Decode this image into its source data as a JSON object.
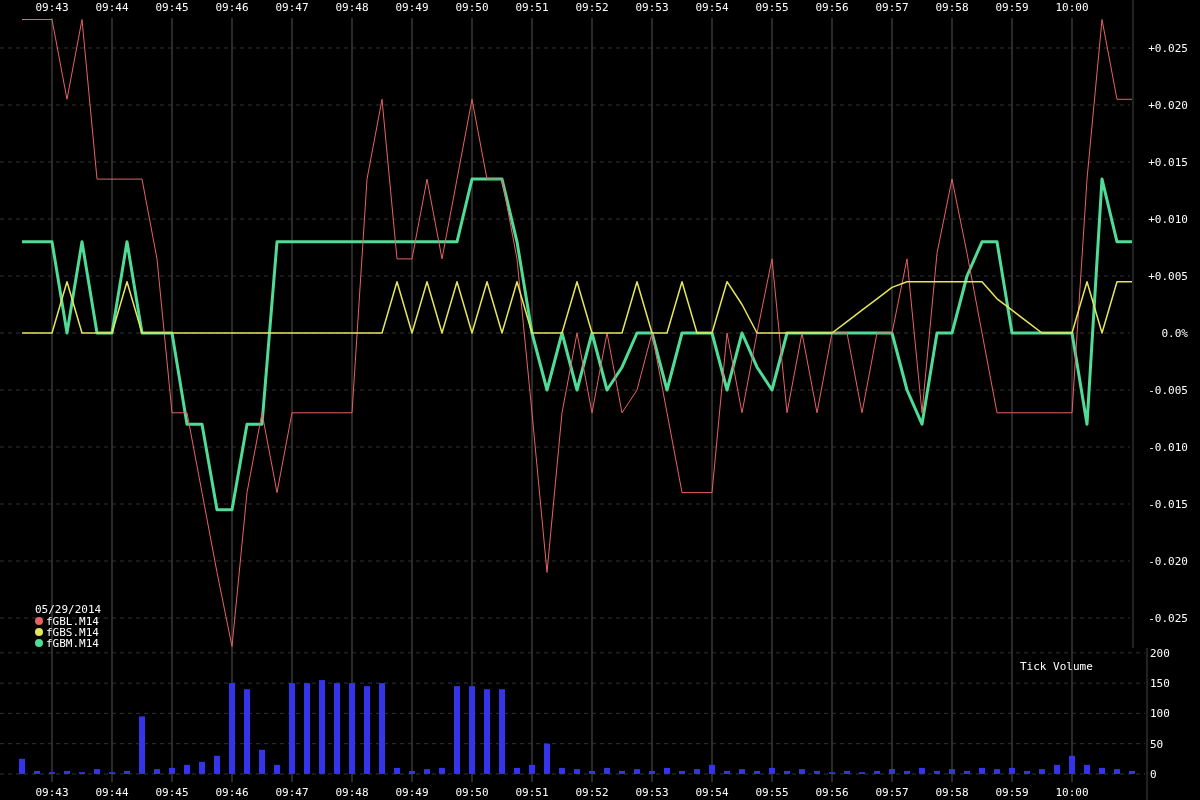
{
  "price_chart": {
    "date": "05/29/2014",
    "chart_data": {
      "type": "line",
      "grid": true,
      "legend": true,
      "ylim": [
        -0.02763,
        0.02921
      ],
      "categories": [
        null,
        null,
        "09:43",
        null,
        null,
        null,
        "09:44",
        null,
        null,
        null,
        "09:45",
        null,
        null,
        null,
        "09:46",
        null,
        null,
        null,
        "09:47",
        null,
        null,
        null,
        "09:48",
        null,
        null,
        null,
        "09:49",
        null,
        null,
        null,
        "09:50",
        null,
        null,
        null,
        "09:51",
        null,
        null,
        null,
        "09:52",
        null,
        null,
        null,
        "09:53",
        null,
        null,
        null,
        "09:54",
        null,
        null,
        null,
        "09:55",
        null,
        null,
        null,
        "09:56",
        null,
        null,
        null,
        "09:57",
        null,
        null,
        null,
        "09:58",
        null,
        null,
        null,
        "09:59",
        null,
        null,
        null,
        "10:00",
        null,
        null,
        null,
        null
      ],
      "yticks": [
        {
          "value": 0.025,
          "label": "+0.025"
        },
        {
          "value": 0.02,
          "label": "+0.020"
        },
        {
          "value": 0.015,
          "label": "+0.015"
        },
        {
          "value": 0.01,
          "label": "+0.010"
        },
        {
          "value": 0.005,
          "label": "+0.005"
        },
        {
          "value": 0,
          "label": "0.0%"
        },
        {
          "value": -0.005,
          "label": "-0.005"
        },
        {
          "value": -0.01,
          "label": "-0.010"
        },
        {
          "value": -0.015,
          "label": "-0.015"
        },
        {
          "value": -0.02,
          "label": "-0.020"
        },
        {
          "value": -0.025,
          "label": "-0.025"
        }
      ],
      "series": [
        {
          "name": "fGBL.M14",
          "color": "#e86262",
          "values": [
            0.0275,
            0.0275,
            0.0275,
            0.0205,
            0.0275,
            0.0135,
            0.0135,
            0.0135,
            0.0135,
            0.0065,
            -0.007,
            -0.007,
            -0.014,
            -0.021,
            -0.0275,
            -0.014,
            -0.007,
            -0.014,
            -0.007,
            -0.007,
            -0.007,
            -0.007,
            -0.007,
            0.0135,
            0.0205,
            0.0065,
            0.0065,
            0.0135,
            0.0065,
            0.0135,
            0.0205,
            0.0135,
            0.0135,
            0.0065,
            -0.007,
            -0.021,
            -0.007,
            0,
            -0.007,
            0,
            -0.007,
            -0.005,
            0,
            -0.007,
            -0.014,
            -0.014,
            -0.014,
            0,
            -0.007,
            0,
            0.0065,
            -0.007,
            0,
            -0.007,
            0,
            0,
            -0.007,
            0,
            0,
            0.0065,
            -0.007,
            0.007,
            0.0135,
            0.007,
            0,
            -0.007,
            -0.007,
            -0.007,
            -0.007,
            -0.007,
            -0.007,
            0.0135,
            0.0275,
            0.0205,
            0.0205
          ]
        },
        {
          "name": "fGBS.M14",
          "color": "#e6e65c",
          "values": [
            0,
            0,
            0,
            0.0045,
            0,
            0,
            0,
            0.0045,
            0,
            0,
            0,
            0,
            0,
            0,
            0,
            0,
            0,
            0,
            0,
            0,
            0,
            0,
            0,
            0,
            0,
            0.0045,
            0,
            0.0045,
            0,
            0.0045,
            0,
            0.0045,
            0,
            0.0045,
            0,
            0,
            0,
            0.0045,
            0,
            0,
            0,
            0.0045,
            0,
            0,
            0.0045,
            0,
            0,
            0.0045,
            0.0025,
            0,
            0,
            0,
            0,
            0,
            0,
            0.001,
            0.002,
            0.003,
            0.004,
            0.0045,
            0.0045,
            0.0045,
            0.0045,
            0.0045,
            0.0045,
            0.003,
            0.002,
            0.001,
            0,
            0,
            0,
            0.0045,
            0,
            0.0045,
            0.0045
          ]
        },
        {
          "name": "fGBM.M14",
          "color": "#50dc96",
          "values": [
            0.008,
            0.008,
            0.008,
            0,
            0.008,
            0,
            0,
            0.008,
            0,
            0,
            0,
            -0.008,
            -0.008,
            -0.0155,
            -0.0155,
            -0.008,
            -0.008,
            0.008,
            0.008,
            0.008,
            0.008,
            0.008,
            0.008,
            0.008,
            0.008,
            0.008,
            0.008,
            0.008,
            0.008,
            0.008,
            0.0135,
            0.0135,
            0.0135,
            0.008,
            0,
            -0.005,
            0,
            -0.005,
            0,
            -0.005,
            -0.003,
            0,
            0,
            -0.005,
            0,
            0,
            0,
            -0.005,
            0,
            -0.003,
            -0.005,
            0,
            0,
            0,
            0,
            0,
            0,
            0,
            0,
            -0.005,
            -0.008,
            0,
            0,
            0.005,
            0.008,
            0.008,
            0,
            0,
            0,
            0,
            0,
            -0.008,
            0.0135,
            0.008,
            0.008
          ]
        }
      ]
    }
  },
  "volume_chart": {
    "chart_data": {
      "type": "bar",
      "title": "Tick Volume",
      "grid": true,
      "ylim": [
        -43,
        208
      ],
      "categories": [
        null,
        null,
        "09:43",
        null,
        null,
        null,
        "09:44",
        null,
        null,
        null,
        "09:45",
        null,
        null,
        null,
        "09:46",
        null,
        null,
        null,
        "09:47",
        null,
        null,
        null,
        "09:48",
        null,
        null,
        null,
        "09:49",
        null,
        null,
        null,
        "09:50",
        null,
        null,
        null,
        "09:51",
        null,
        null,
        null,
        "09:52",
        null,
        null,
        null,
        "09:53",
        null,
        null,
        null,
        "09:54",
        null,
        null,
        null,
        "09:55",
        null,
        null,
        null,
        "09:56",
        null,
        null,
        null,
        "09:57",
        null,
        null,
        null,
        "09:58",
        null,
        null,
        null,
        "09:59",
        null,
        null,
        null,
        "10:00",
        null,
        null,
        null,
        null
      ],
      "yticks": [
        200,
        150,
        100,
        50,
        0
      ],
      "series": [
        {
          "color": "#3434e8",
          "values": [
            25,
            5,
            3,
            5,
            3,
            8,
            3,
            5,
            95,
            8,
            10,
            15,
            20,
            30,
            150,
            140,
            40,
            15,
            150,
            150,
            155,
            150,
            150,
            145,
            150,
            10,
            5,
            8,
            10,
            145,
            145,
            140,
            140,
            10,
            15,
            50,
            10,
            8,
            5,
            10,
            5,
            8,
            5,
            10,
            5,
            8,
            15,
            5,
            8,
            5,
            10,
            5,
            8,
            5,
            3,
            5,
            3,
            5,
            8,
            5,
            10,
            5,
            8,
            5,
            10,
            8,
            10,
            5,
            8,
            15,
            30,
            15,
            10,
            8,
            5
          ]
        }
      ]
    }
  }
}
